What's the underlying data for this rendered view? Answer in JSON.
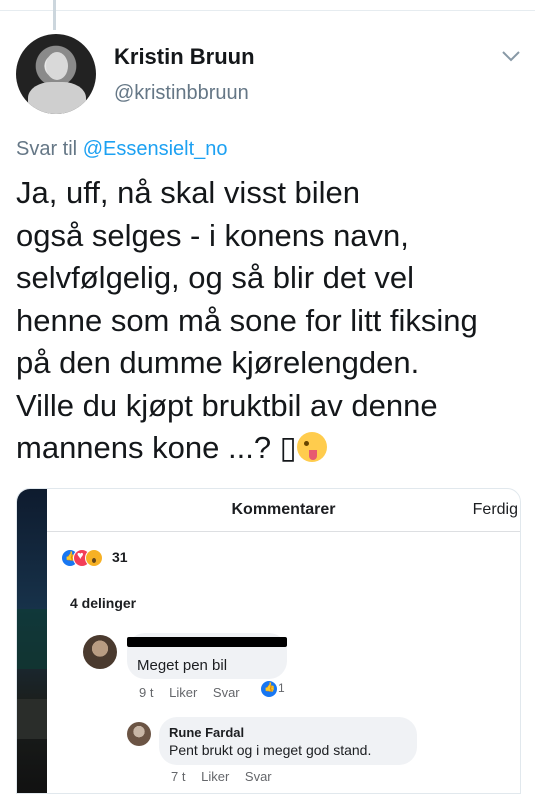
{
  "tweet": {
    "author_name": "Kristin Bruun",
    "author_handle": "@kristinbbruun",
    "reply_prefix": "Svar til",
    "reply_to": "@Essensielt_no",
    "text": "Ja, uff, nå skal visst bilen\nogså selges - i konens navn,\nselvfølgelig, og så blir det vel\nhenne som må sone for litt fiksing\npå den dumme kjørelengden.\nVille du kjøpt bruktbil av denne\nmannens kone ...? ",
    "trailing_glyph": "▯"
  },
  "fb": {
    "header_title": "Kommentarer",
    "done_label": "Ferdig",
    "reaction_count": "31",
    "shares": "4 delinger",
    "comments": [
      {
        "author": "",
        "text": "Meget pen bil",
        "time": "9 t",
        "like_label": "Liker",
        "reply_label": "Svar",
        "likes": "1"
      },
      {
        "author": "Rune Fardal",
        "text": "Pent brukt og i meget god stand.",
        "time": "7 t",
        "like_label": "Liker",
        "reply_label": "Svar"
      }
    ]
  },
  "icons": [
    "avatar",
    "chevron-down-icon",
    "like-reaction-icon",
    "love-reaction-icon",
    "wow-reaction-icon",
    "tongue-emoji-icon"
  ],
  "colors": {
    "link": "#1da1f2",
    "secondary": "#657786",
    "fb_blue": "#1877f2"
  }
}
